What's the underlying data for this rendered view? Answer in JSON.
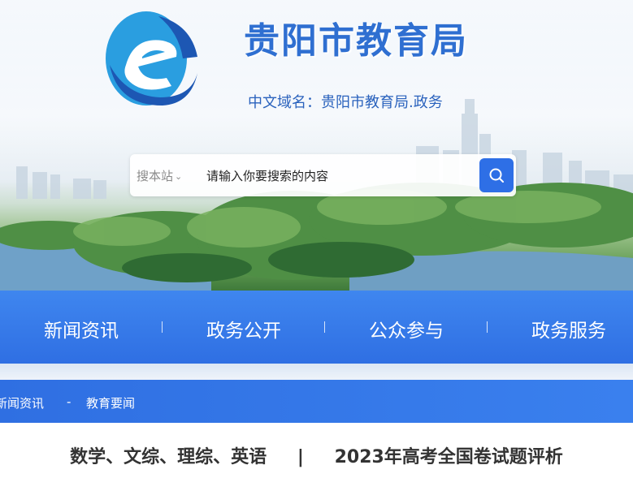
{
  "header": {
    "site_title": "贵阳市教育局",
    "domain_line": "中文域名：贵阳市教育局.政务"
  },
  "search": {
    "scope_label": "搜本站",
    "placeholder": "请输入你要搜索的内容"
  },
  "nav": {
    "items": [
      {
        "label": "新闻资讯"
      },
      {
        "label": "政务公开"
      },
      {
        "label": "公众参与"
      },
      {
        "label": "政务服务"
      }
    ]
  },
  "breadcrumb": {
    "items": [
      "新闻资讯",
      "教育要闻"
    ],
    "separator": "-"
  },
  "article": {
    "title_left": "数学、文综、理综、英语",
    "divider": "|",
    "title_right": "2023年高考全国卷试题评析"
  },
  "icons": {
    "logo": "education-bureau-e-logo-icon",
    "search": "search-icon",
    "scope": "chevron-down-icon"
  },
  "colors": {
    "brand_blue": "#2f6fd1",
    "nav_blue": "#2f6fe3",
    "button_blue": "#2e6fe6"
  }
}
